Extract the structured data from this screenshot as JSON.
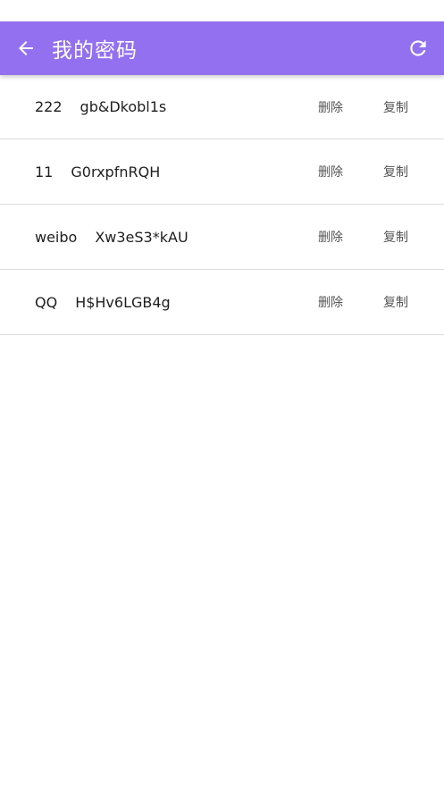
{
  "header": {
    "title": "我的密码",
    "back_icon": "arrow-left-icon",
    "refresh_icon": "refresh-icon",
    "bar_color": "#9370ef"
  },
  "items": [
    {
      "account": "222",
      "password": "gb&Dkobl1s",
      "delete_label": "删除",
      "copy_label": "复制"
    },
    {
      "account": "11",
      "password": "G0rxpfnRQH",
      "delete_label": "删除",
      "copy_label": "复制"
    },
    {
      "account": "weibo",
      "password": "Xw3eS3*kAU",
      "delete_label": "删除",
      "copy_label": "复制"
    },
    {
      "account": "QQ",
      "password": "H$Hv6LGB4g",
      "delete_label": "删除",
      "copy_label": "复制"
    }
  ]
}
